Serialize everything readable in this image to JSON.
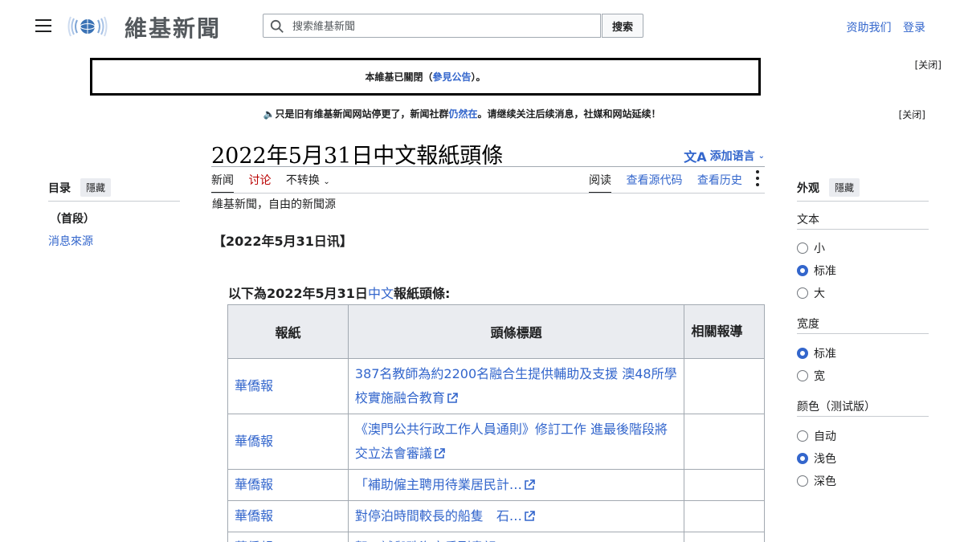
{
  "header": {
    "site_name": "維基新聞",
    "search_placeholder": "搜索維基新聞",
    "search_button": "搜索",
    "donate": "资助我们",
    "login": "登录"
  },
  "notices": {
    "closed_prefix": "本維基已關閉（",
    "closed_link": "參見公告",
    "closed_suffix": "）。",
    "close_label": "[关闭]",
    "banner_prefix": "🔈只是旧有维基新闻网站停更了，新闻社群",
    "banner_link": "仍然在",
    "banner_suffix": "。请继续关注后续消息，社媒和网站延续！",
    "close_label2": "[关闭]"
  },
  "page": {
    "title": "2022年5月31日中文報紙頭條",
    "add_language": "添加语言",
    "tabs": {
      "news": "新闻",
      "talk": "讨论",
      "variant": "不转换",
      "read": "阅读",
      "view_source": "查看源代码",
      "history": "查看历史"
    },
    "tagline": "維基新聞，自由的新聞源",
    "date_heading": "【2022年5月31日讯】",
    "intro_prefix": "以下為2022年5月31日",
    "intro_link": "中文",
    "intro_suffix": "報紙頭條:"
  },
  "table": {
    "headers": [
      "報紙",
      "頭條標題",
      "相關報導"
    ],
    "rows": [
      {
        "paper": "華僑報",
        "headline": "387名教師為約2200名融合生提供輔助及支援 澳48所學校實施融合教育"
      },
      {
        "paper": "華僑報",
        "headline": "《澳門公共行政工作人員通則》修訂工作 進最後階段將交立法會審議"
      },
      {
        "paper": "華僑報",
        "headline": "「補助僱主聘用待業居民計…"
      },
      {
        "paper": "華僑報",
        "headline": "對停泊時間較長的船隻　石…"
      },
      {
        "paper": "華僑報",
        "headline": "賀一試與珠海市委副書記…"
      }
    ]
  },
  "toc": {
    "title": "目录",
    "hide": "隱藏",
    "top": "（首段）",
    "items": [
      "消息來源"
    ]
  },
  "appearance": {
    "title": "外观",
    "hide": "隱藏",
    "text_label": "文本",
    "text_options": [
      "小",
      "标准",
      "大"
    ],
    "text_selected": "标准",
    "width_label": "宽度",
    "width_options": [
      "标准",
      "宽"
    ],
    "width_selected": "标准",
    "color_label": "颜色（测试版）",
    "color_options": [
      "自动",
      "浅色",
      "深色"
    ],
    "color_selected": "浅色"
  },
  "colors": {
    "link": "#3366cc",
    "border": "#a2a9b1",
    "header_bg": "#eaecf0"
  }
}
